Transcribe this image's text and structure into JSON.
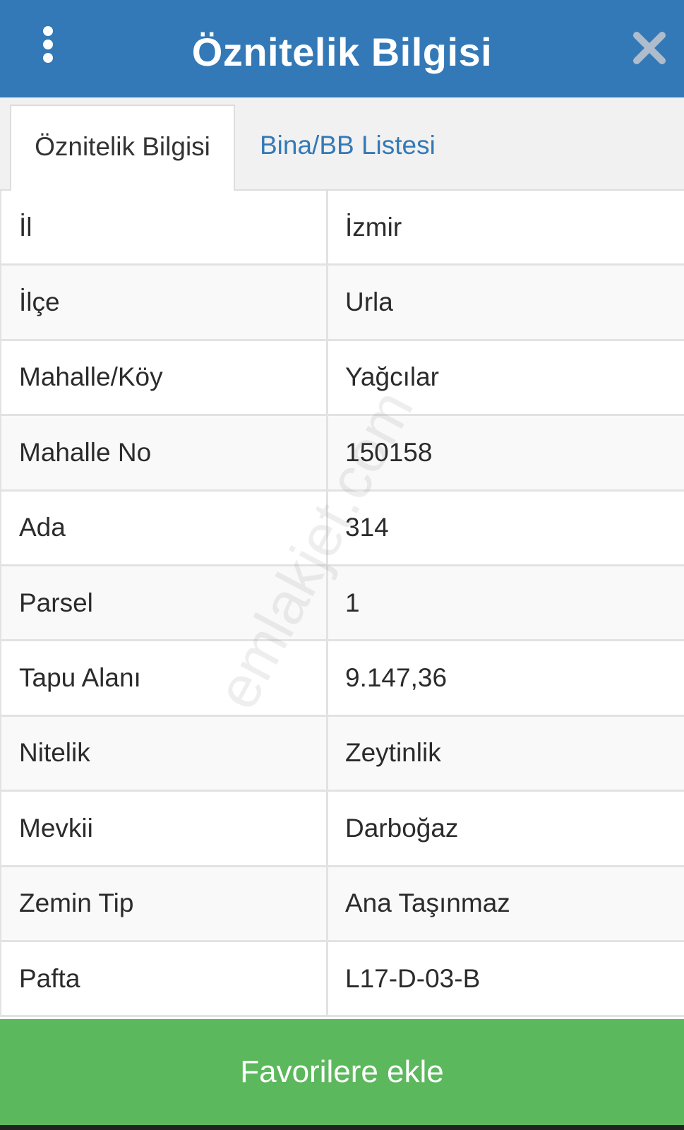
{
  "header": {
    "title": "Öznitelik Bilgisi",
    "menu_icon": "vertical-dots-icon",
    "close_icon": "close-icon",
    "color": "#3379b7"
  },
  "tabs": [
    {
      "label": "Öznitelik Bilgisi",
      "active": true
    },
    {
      "label": "Bina/BB Listesi",
      "active": false
    }
  ],
  "attributes": [
    {
      "key": "İl",
      "value": "İzmir"
    },
    {
      "key": "İlçe",
      "value": "Urla"
    },
    {
      "key": "Mahalle/Köy",
      "value": "Yağcılar"
    },
    {
      "key": "Mahalle No",
      "value": "150158"
    },
    {
      "key": "Ada",
      "value": "314"
    },
    {
      "key": "Parsel",
      "value": "1"
    },
    {
      "key": "Tapu Alanı",
      "value": "9.147,36"
    },
    {
      "key": "Nitelik",
      "value": "Zeytinlik"
    },
    {
      "key": "Mevkii",
      "value": "Darboğaz"
    },
    {
      "key": "Zemin Tip",
      "value": "Ana Taşınmaz"
    },
    {
      "key": "Pafta",
      "value": "L17-D-03-B"
    }
  ],
  "watermark": "emlakjet.com",
  "footer": {
    "button_label": "Favorilere ekle",
    "button_color": "#5cb85c"
  }
}
